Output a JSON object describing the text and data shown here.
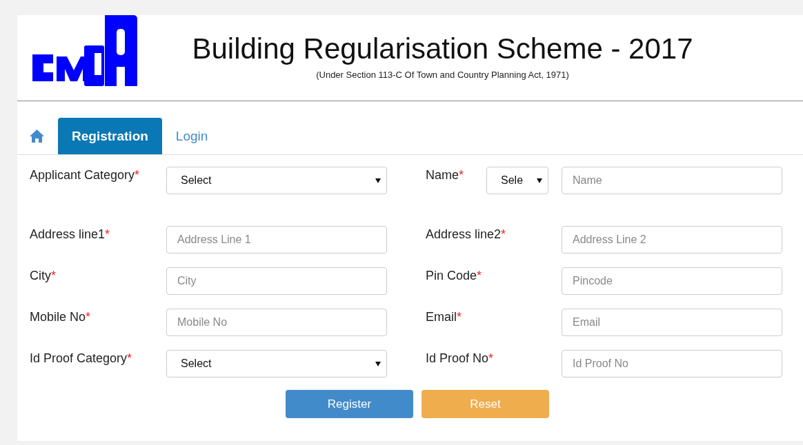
{
  "header": {
    "title": "Building Regularisation Scheme - 2017",
    "subtitle": "(Under Section 113-C Of Town and Country Planning Act, 1971)"
  },
  "tabs": [
    {
      "kind": "home",
      "selected": false
    },
    {
      "kind": "text",
      "label": "Registration",
      "selected": true
    },
    {
      "kind": "text",
      "label": "Login",
      "selected": false
    }
  ],
  "form": {
    "rows": [
      {
        "fields": [
          {
            "label": "Applicant Category",
            "marker": "*",
            "controls": [
              {
                "kind": "select",
                "value": "Select"
              }
            ]
          },
          {
            "label": "Name",
            "marker": "*",
            "controls": [
              {
                "kind": "select",
                "value": "Sele",
                "compact": true
              },
              {
                "kind": "input",
                "placeholder": "Name"
              }
            ]
          }
        ]
      },
      {
        "fields": [
          {
            "label": "Address line1",
            "marker": "*",
            "controls": [
              {
                "kind": "input",
                "placeholder": "Address Line 1"
              }
            ]
          },
          {
            "label": "Address line2",
            "marker": "*",
            "controls": [
              {
                "kind": "input",
                "placeholder": "Address Line 2"
              }
            ]
          }
        ]
      },
      {
        "fields": [
          {
            "label": "City",
            "marker": "*",
            "controls": [
              {
                "kind": "input",
                "placeholder": "City"
              }
            ]
          },
          {
            "label": "Pin Code",
            "marker": "*",
            "controls": [
              {
                "kind": "input",
                "placeholder": "Pincode"
              }
            ]
          }
        ]
      },
      {
        "fields": [
          {
            "label": "Mobile No",
            "marker": "*",
            "controls": [
              {
                "kind": "input",
                "placeholder": "Mobile No"
              }
            ]
          },
          {
            "label": "Email",
            "marker": "*",
            "controls": [
              {
                "kind": "input",
                "placeholder": "Email"
              }
            ]
          }
        ]
      },
      {
        "fields": [
          {
            "label": "Id Proof Category",
            "marker": "*",
            "controls": [
              {
                "kind": "select",
                "value": "Select"
              }
            ]
          },
          {
            "label": "Id Proof No",
            "marker": "*",
            "controls": [
              {
                "kind": "input",
                "placeholder": "Id Proof No"
              }
            ]
          }
        ]
      }
    ]
  },
  "buttons": [
    {
      "kind": "primary",
      "label": "Register"
    },
    {
      "kind": "warning",
      "label": "Reset"
    }
  ]
}
